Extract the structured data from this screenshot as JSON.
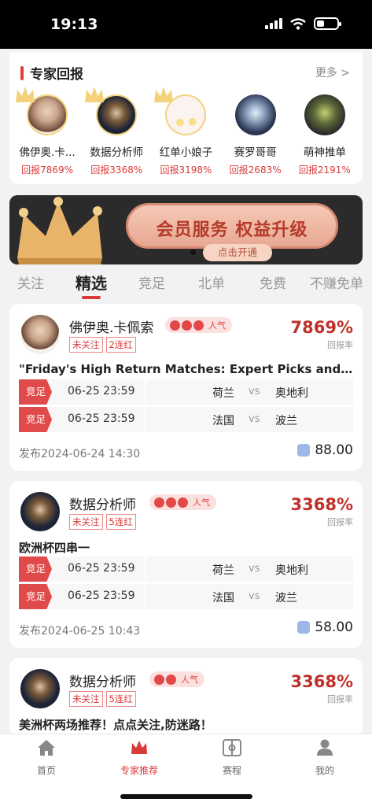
{
  "status_bar": {
    "time": "19:13"
  },
  "experts": {
    "title": "专家回报",
    "more": "更多 >",
    "items": [
      {
        "name": "佛伊奥.卡...",
        "return": "回报7869%"
      },
      {
        "name": "数据分析师",
        "return": "回报3368%"
      },
      {
        "name": "红单小娘子",
        "return": "回报3198%"
      },
      {
        "name": "赛罗哥哥",
        "return": "回报2683%"
      },
      {
        "name": "萌神推单",
        "return": "回报2191%"
      }
    ]
  },
  "banner": {
    "text": "会员服务 权益升级",
    "button": "点击开通"
  },
  "tabs": [
    {
      "label": "关注"
    },
    {
      "label": "精选"
    },
    {
      "label": "竞足"
    },
    {
      "label": "北单"
    },
    {
      "label": "免费"
    },
    {
      "label": "不赚免单"
    }
  ],
  "posts": [
    {
      "name": "佛伊奥.卡佩索",
      "hot": "人气",
      "tags": [
        "未关注",
        "2连红"
      ],
      "rate": "7869%",
      "rate_label": "回报率",
      "title": "\"Friday's High Return Matches: Expert Picks and Analysis\"",
      "matches": [
        {
          "badge": "竞足",
          "time": "06-25 23:59",
          "home": "荷兰",
          "vs": "vs",
          "away": "奥地利"
        },
        {
          "badge": "竞足",
          "time": "06-25 23:59",
          "home": "法国",
          "vs": "vs",
          "away": "波兰"
        }
      ],
      "date": "发布2024-06-24 14:30",
      "price": "88.00"
    },
    {
      "name": "数据分析师",
      "hot": "人气",
      "tags": [
        "未关注",
        "5连红"
      ],
      "rate": "3368%",
      "rate_label": "回报率",
      "title": "欧洲杯四串一",
      "matches": [
        {
          "badge": "竞足",
          "time": "06-25 23:59",
          "home": "荷兰",
          "vs": "vs",
          "away": "奥地利"
        },
        {
          "badge": "竞足",
          "time": "06-25 23:59",
          "home": "法国",
          "vs": "vs",
          "away": "波兰"
        }
      ],
      "date": "发布2024-06-25 10:43",
      "price": "58.00"
    },
    {
      "name": "数据分析师",
      "hot": "人气",
      "tags": [
        "未关注",
        "5连红"
      ],
      "rate": "3368%",
      "rate_label": "回报率",
      "title": "美洲杯两场推荐！点点关注,防迷路！"
    }
  ],
  "bottom_nav": [
    {
      "label": "首页"
    },
    {
      "label": "专家推荐"
    },
    {
      "label": "赛程"
    },
    {
      "label": "我的"
    }
  ],
  "colors": {
    "accent": "#d93a3a",
    "rate": "#c0302a"
  }
}
